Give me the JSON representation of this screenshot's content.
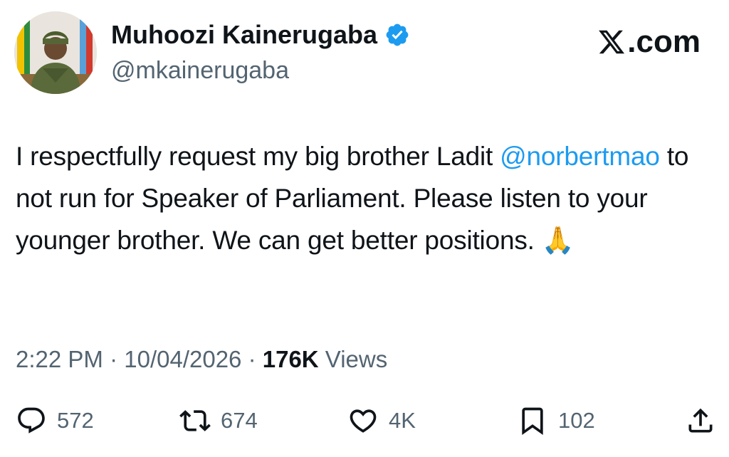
{
  "author": {
    "display_name": "Muhoozi Kainerugaba",
    "handle": "@mkainerugaba",
    "verified": true
  },
  "brand": {
    "label": ".com",
    "icon": "x-logo-icon"
  },
  "tweet": {
    "text_before_mention": "I respectfully request my big brother Ladit ",
    "mention": "@norbertmao",
    "text_after_mention": " to not run for Speaker of Parliament. Please listen to your younger brother. We can get better positions. ",
    "emoji": "🙏"
  },
  "meta": {
    "time": "2:22 PM",
    "separator": " · ",
    "date": "10/04/2026",
    "views_count": "176K",
    "views_label": " Views"
  },
  "actions": {
    "replies": "572",
    "reposts": "674",
    "likes": "4K",
    "bookmarks": "102"
  },
  "colors": {
    "accent": "#1d9bf0",
    "text": "#0f1419",
    "secondary": "#536471"
  }
}
